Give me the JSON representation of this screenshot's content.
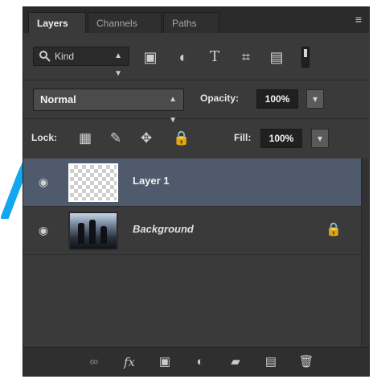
{
  "tabs": [
    {
      "label": "Layers",
      "active": true
    },
    {
      "label": "Channels",
      "active": false
    },
    {
      "label": "Paths",
      "active": false
    }
  ],
  "panel_menu_icon": "menu-icon",
  "filter": {
    "kind_label": "Kind",
    "icons": [
      "pixel-layer-filter-icon",
      "adjustment-layer-filter-icon",
      "type-layer-filter-icon",
      "shape-layer-filter-icon",
      "smart-object-filter-icon"
    ]
  },
  "blend": {
    "mode": "Normal",
    "opacity_label": "Opacity:",
    "opacity_value": "100%"
  },
  "lock": {
    "label": "Lock:",
    "fill_label": "Fill:",
    "fill_value": "100%"
  },
  "layers": [
    {
      "name": "Layer 1",
      "visible": true,
      "selected": true,
      "locked": false
    },
    {
      "name": "Background",
      "visible": true,
      "selected": false,
      "locked": true
    }
  ],
  "colors": {
    "panel_bg": "#3a3a3a",
    "selected_row": "#4f5a6c",
    "pointer_blue": "#12a7ee"
  }
}
